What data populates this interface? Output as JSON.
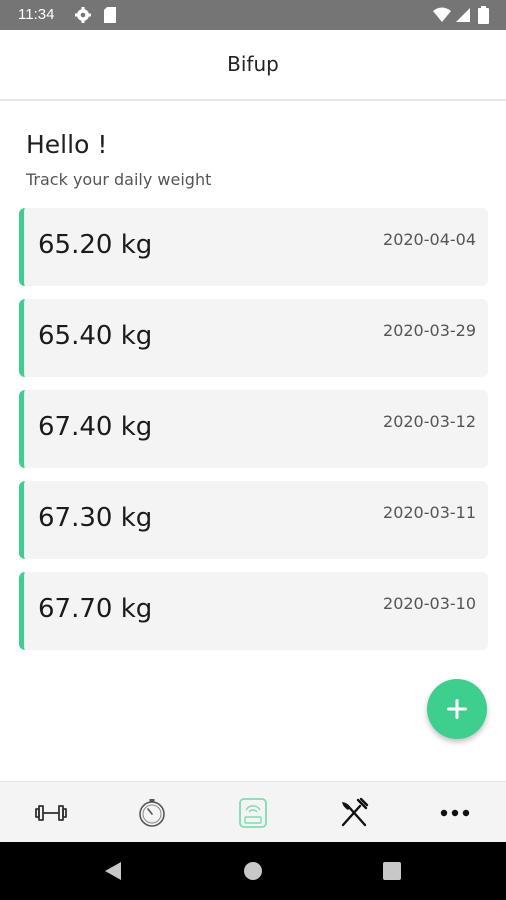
{
  "status_bar": {
    "time": "11:34",
    "icons": [
      "settings-icon",
      "sim-card-icon",
      "wifi-icon",
      "signal-icon",
      "battery-icon"
    ]
  },
  "app_bar": {
    "title": "Bifup"
  },
  "greeting": {
    "title": "Hello !",
    "subtitle": "Track your daily weight"
  },
  "entries": [
    {
      "weight": "65.20 kg",
      "date": "2020-04-04"
    },
    {
      "weight": "65.40 kg",
      "date": "2020-03-29"
    },
    {
      "weight": "67.40 kg",
      "date": "2020-03-12"
    },
    {
      "weight": "67.30 kg",
      "date": "2020-03-11"
    },
    {
      "weight": "67.70 kg",
      "date": "2020-03-10"
    }
  ],
  "fab": {
    "icon": "plus-icon"
  },
  "bottom_nav": {
    "items": [
      {
        "icon": "dumbbell-icon",
        "active": false
      },
      {
        "icon": "stopwatch-icon",
        "active": false
      },
      {
        "icon": "scale-icon",
        "active": true
      },
      {
        "icon": "fork-knife-icon",
        "active": false
      },
      {
        "icon": "more-icon",
        "active": false
      }
    ]
  },
  "system_nav": [
    "back-icon",
    "home-icon",
    "recents-icon"
  ],
  "colors": {
    "accent": "#3ecf8e",
    "status_bar": "#757575",
    "card": "#f4f4f4"
  }
}
